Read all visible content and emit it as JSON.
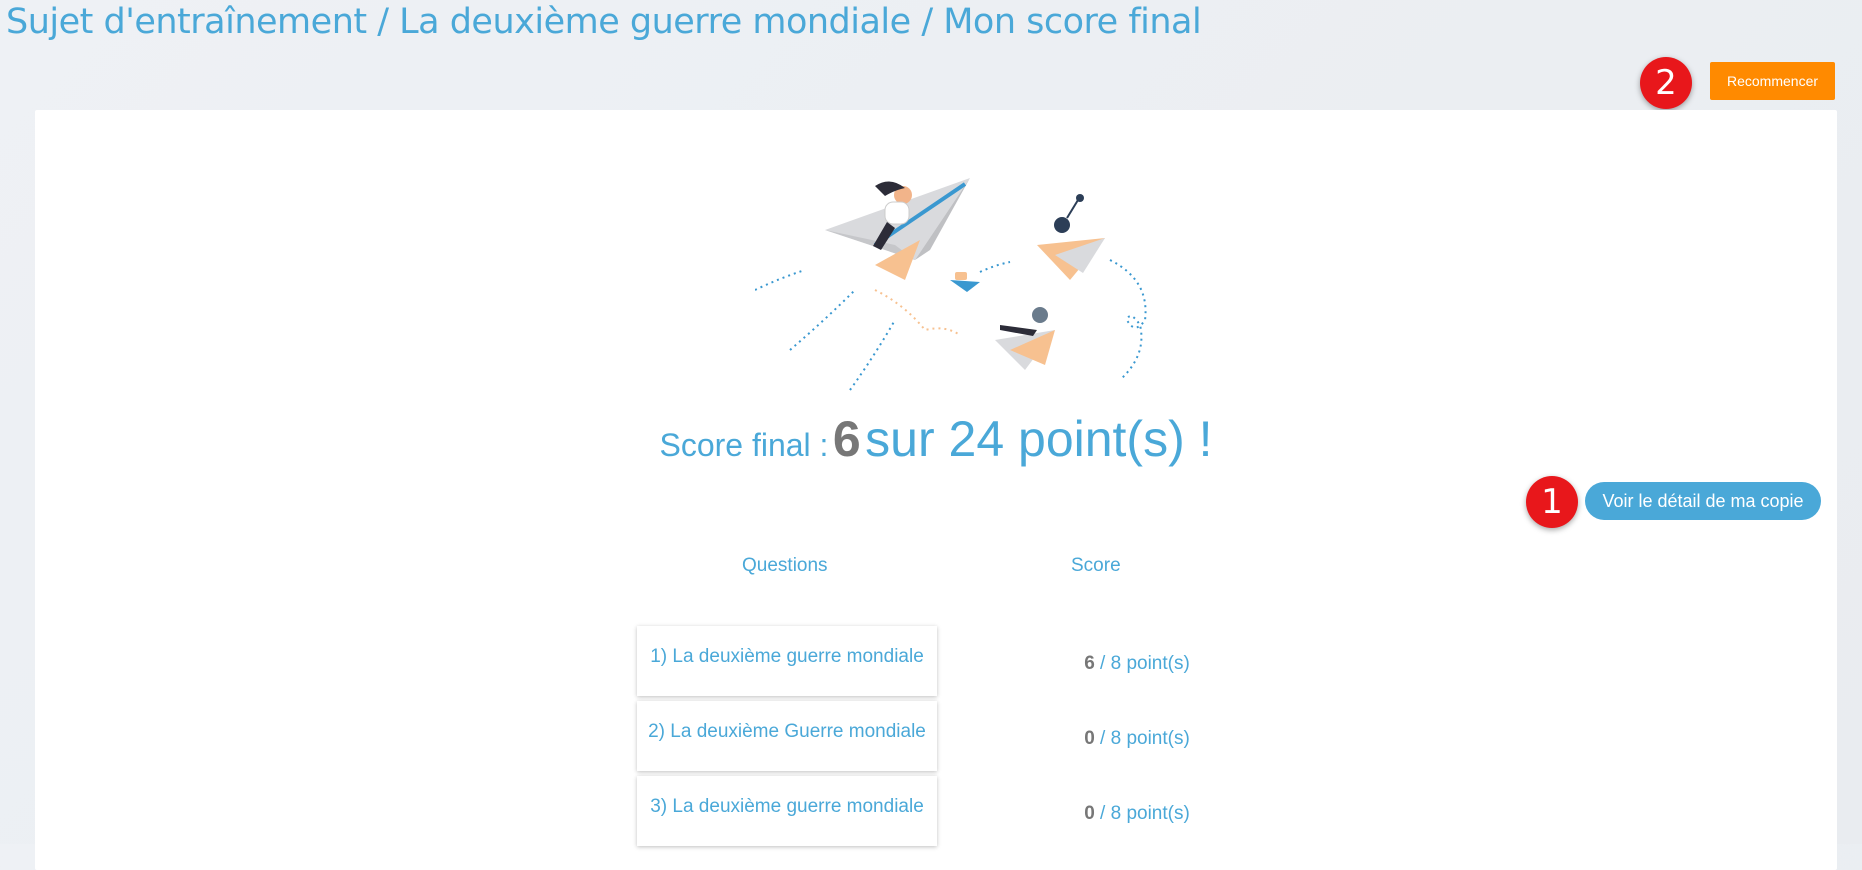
{
  "breadcrumb": {
    "text": "Sujet d'entraînement / La deuxième guerre mondiale / Mon score final"
  },
  "header": {
    "restart_label": "Recommencer"
  },
  "markers": {
    "one": "1",
    "two": "2"
  },
  "result": {
    "label": "Score final :",
    "obtained": "6",
    "rest": "sur 24 point(s) !"
  },
  "detail_button": {
    "label": "Voir le détail de ma copie"
  },
  "table": {
    "headers": {
      "questions": "Questions",
      "score": "Score"
    },
    "rows": [
      {
        "question": "1) La deuxième guerre mondiale",
        "obtained": "6",
        "total": "/ 8 point(s)"
      },
      {
        "question": "2) La deuxième Guerre mondiale",
        "obtained": "0",
        "total": "/ 8 point(s)"
      },
      {
        "question": "3) La deuxième guerre mondiale",
        "obtained": "0",
        "total": "/ 8 point(s)"
      }
    ]
  },
  "colors": {
    "accent": "#4aa8d8",
    "restart": "#ff8a00",
    "marker": "#e8171b",
    "score_number": "#777777"
  },
  "icons": {
    "illustration": "paper-planes-illustration"
  }
}
